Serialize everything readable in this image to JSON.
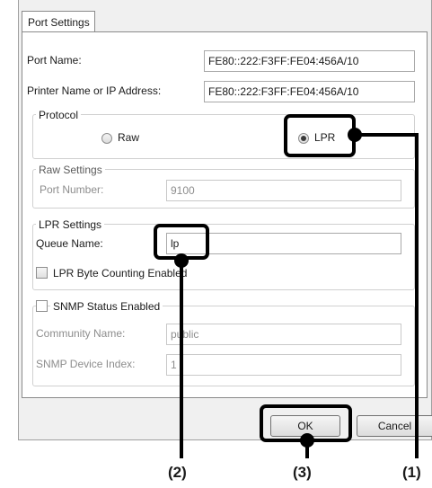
{
  "tab": {
    "label": "Port Settings"
  },
  "port_name": {
    "label": "Port Name:",
    "value": "FE80::222:F3FF:FE04:456A/10"
  },
  "printer_name": {
    "label": "Printer Name or IP Address:",
    "value": "FE80::222:F3FF:FE04:456A/10"
  },
  "protocol": {
    "legend": "Protocol",
    "raw_label": "Raw",
    "lpr_label": "LPR",
    "selected": "LPR"
  },
  "raw_settings": {
    "legend": "Raw Settings",
    "port_number_label": "Port Number:",
    "port_number_value": "9100"
  },
  "lpr_settings": {
    "legend": "LPR Settings",
    "queue_name_label": "Queue Name:",
    "queue_name_value": "lp",
    "byte_counting_label": "LPR Byte Counting Enabled",
    "byte_counting_checked": false
  },
  "snmp": {
    "status_label": "SNMP Status Enabled",
    "status_checked": false,
    "community_label": "Community Name:",
    "community_value": "public",
    "device_index_label": "SNMP Device Index:",
    "device_index_value": "1"
  },
  "buttons": {
    "ok": "OK",
    "cancel": "Cancel"
  },
  "callouts": {
    "c1": "(1)",
    "c2": "(2)",
    "c3": "(3)"
  },
  "colors": {
    "callout_border": "#000000",
    "dialog_bg": "#f0f0f0",
    "panel_bg": "#ffffff",
    "disabled_text": "#8d8d8d"
  }
}
